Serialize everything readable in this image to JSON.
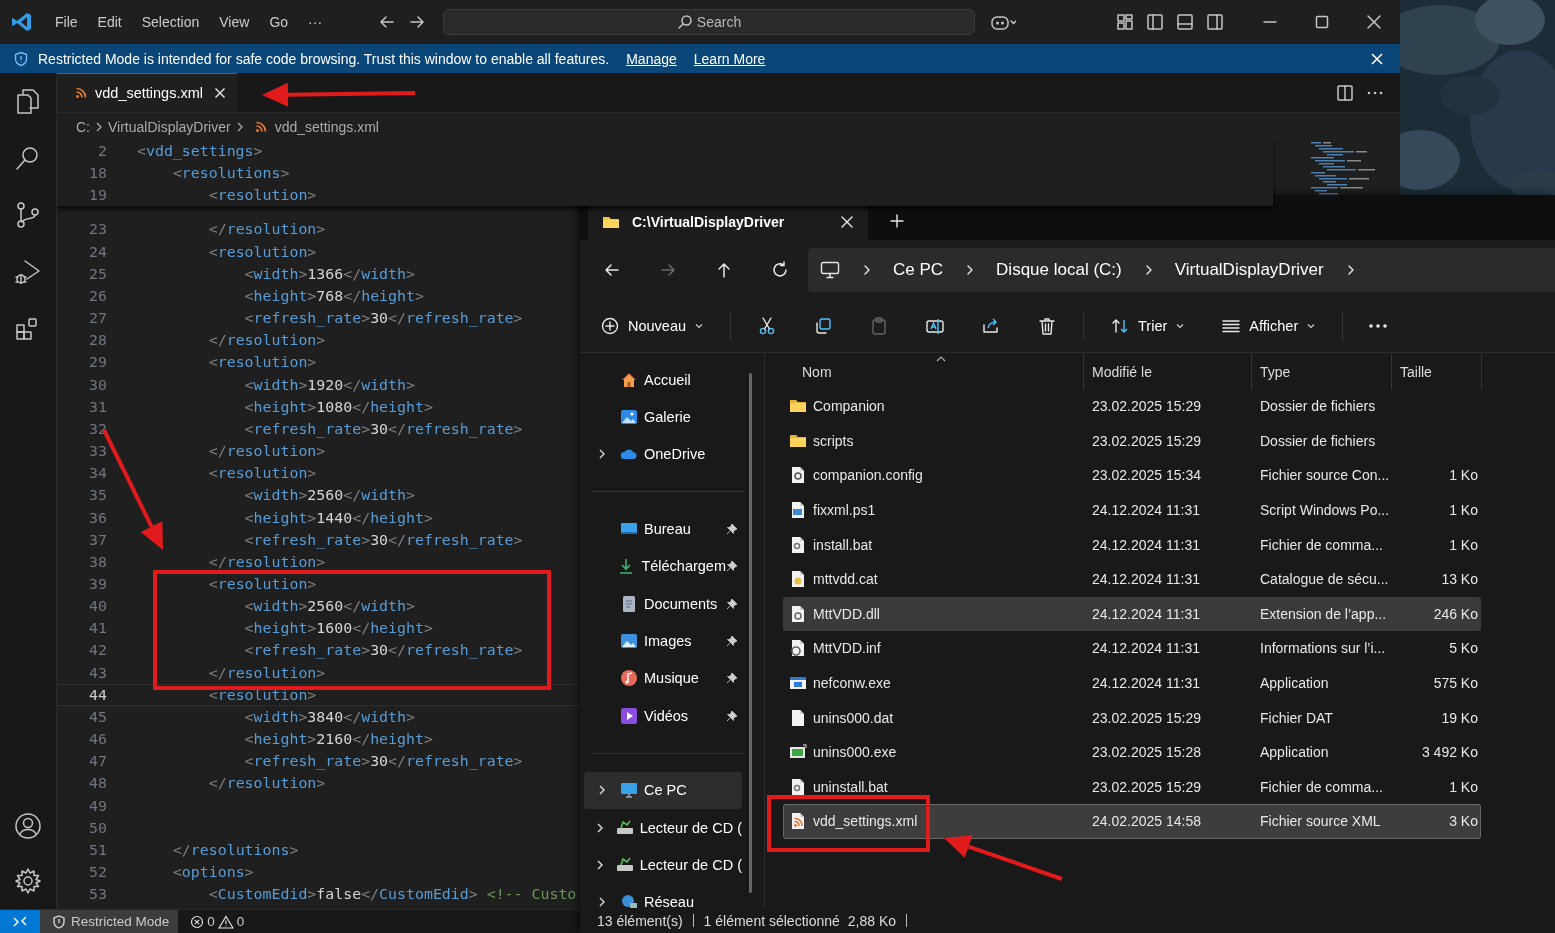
{
  "vscode": {
    "menu": [
      "File",
      "Edit",
      "Selection",
      "View",
      "Go",
      "···"
    ],
    "search": {
      "placeholder": "Search"
    },
    "banner": {
      "text": "Restricted Mode is intended for safe code browsing. Trust this window to enable all features.",
      "links": [
        "Manage",
        "Learn More"
      ]
    },
    "tabs": [
      {
        "label": "vdd_settings.xml",
        "selected": true
      }
    ],
    "breadcrumb": [
      "C:",
      "VirtualDisplayDriver",
      "vdd_settings.xml"
    ],
    "sticky_lines": [
      {
        "number": "2",
        "text": "<vdd_settings>"
      },
      {
        "number": "18",
        "text": "    <resolutions>"
      },
      {
        "number": "19",
        "text": "        <resolution>"
      }
    ],
    "lines": [
      {
        "number": "23",
        "text": "        </resolution>",
        "current": false
      },
      {
        "number": "24",
        "text": "        <resolution>",
        "current": false
      },
      {
        "number": "25",
        "text": "            <width>1366</width>",
        "current": false
      },
      {
        "number": "26",
        "text": "            <height>768</height>",
        "current": false
      },
      {
        "number": "27",
        "text": "            <refresh_rate>30</refresh_rate>",
        "current": false
      },
      {
        "number": "28",
        "text": "        </resolution>",
        "current": false
      },
      {
        "number": "29",
        "text": "        <resolution>",
        "current": false
      },
      {
        "number": "30",
        "text": "            <width>1920</width>",
        "current": false
      },
      {
        "number": "31",
        "text": "            <height>1080</height>",
        "current": false
      },
      {
        "number": "32",
        "text": "            <refresh_rate>30</refresh_rate>",
        "current": false
      },
      {
        "number": "33",
        "text": "        </resolution>",
        "current": false
      },
      {
        "number": "34",
        "text": "        <resolution>",
        "current": false
      },
      {
        "number": "35",
        "text": "            <width>2560</width>",
        "current": false
      },
      {
        "number": "36",
        "text": "            <height>1440</height>",
        "current": false
      },
      {
        "number": "37",
        "text": "            <refresh_rate>30</refresh_rate>",
        "current": false
      },
      {
        "number": "38",
        "text": "        </resolution>",
        "current": false
      },
      {
        "number": "39",
        "text": "        <resolution>",
        "current": false
      },
      {
        "number": "40",
        "text": "            <width>2560</width>",
        "current": false
      },
      {
        "number": "41",
        "text": "            <height>1600</height>",
        "current": false
      },
      {
        "number": "42",
        "text": "            <refresh_rate>30</refresh_rate>",
        "current": false
      },
      {
        "number": "43",
        "text": "        </resolution>",
        "current": false
      },
      {
        "number": "44",
        "text": "        <resolution>",
        "current": true
      },
      {
        "number": "45",
        "text": "            <width>3840</width>",
        "current": false
      },
      {
        "number": "46",
        "text": "            <height>2160</height>",
        "current": false
      },
      {
        "number": "47",
        "text": "            <refresh_rate>30</refresh_rate>",
        "current": false
      },
      {
        "number": "48",
        "text": "        </resolution>",
        "current": false
      },
      {
        "number": "49",
        "current": false
      },
      {
        "number": "50",
        "current": false
      },
      {
        "number": "51",
        "text": "    </resolutions>",
        "current": false
      },
      {
        "number": "52",
        "text": "    <options>",
        "current": false
      },
      {
        "number": "53",
        "text": "        <CustomEdid>false</CustomEdid> <!-- Custo",
        "current": false
      }
    ],
    "status_bar": {
      "mode": "Restricted Mode",
      "errors": "0",
      "warnings": "0"
    }
  },
  "explorer": {
    "tab": {
      "title": "C:\\VirtualDisplayDriver"
    },
    "nav_buttons": [
      {
        "kind": "back",
        "disabled": false
      },
      {
        "kind": "forward",
        "disabled": true
      },
      {
        "kind": "up",
        "disabled": false
      },
      {
        "kind": "refresh",
        "disabled": false
      }
    ],
    "address": [
      "Ce PC",
      "Disque local (C:)",
      "VirtualDisplayDriver"
    ],
    "toolbar": [
      {
        "kind": "new",
        "label": "Nouveau",
        "disabled": false
      },
      {
        "kind": "cut",
        "disabled": false
      },
      {
        "kind": "copy",
        "disabled": false
      },
      {
        "kind": "paste",
        "disabled": true
      },
      {
        "kind": "rename",
        "disabled": false
      },
      {
        "kind": "share",
        "disabled": false
      },
      {
        "kind": "delete",
        "disabled": false
      },
      {
        "kind": "sort",
        "label": "Trier",
        "disabled": false
      },
      {
        "kind": "view",
        "label": "Afficher",
        "disabled": false
      },
      {
        "kind": "more",
        "disabled": false
      }
    ],
    "navigation": [
      {
        "items": [
          {
            "label": "Accueil",
            "kind": "home",
            "expandable": false,
            "pinned": false,
            "selected": false
          },
          {
            "label": "Galerie",
            "kind": "gallery",
            "expandable": false,
            "pinned": false,
            "selected": false
          },
          {
            "label": "OneDrive",
            "kind": "cloud",
            "expandable": true,
            "pinned": false,
            "selected": false
          }
        ]
      },
      {
        "items": [
          {
            "label": "Bureau",
            "kind": "desktop",
            "expandable": false,
            "pinned": true,
            "selected": false
          },
          {
            "label": "Téléchargem",
            "kind": "downloads",
            "expandable": false,
            "pinned": true,
            "selected": false
          },
          {
            "label": "Documents",
            "kind": "documents",
            "expandable": false,
            "pinned": true,
            "selected": false
          },
          {
            "label": "Images",
            "kind": "pictures",
            "expandable": false,
            "pinned": true,
            "selected": false
          },
          {
            "label": "Musique",
            "kind": "music",
            "expandable": false,
            "pinned": true,
            "selected": false
          },
          {
            "label": "Vidéos",
            "kind": "videos",
            "expandable": false,
            "pinned": true,
            "selected": false
          }
        ]
      },
      {
        "items": [
          {
            "label": "Ce PC",
            "kind": "computer",
            "expandable": true,
            "pinned": false,
            "selected": true
          },
          {
            "label": "Lecteur de CD (",
            "kind": "cd-drive",
            "expandable": true,
            "pinned": false,
            "selected": false
          },
          {
            "label": "Lecteur de CD (",
            "kind": "cd-drive",
            "expandable": true,
            "pinned": false,
            "selected": false
          },
          {
            "label": "Réseau",
            "kind": "network",
            "expandable": true,
            "pinned": false,
            "selected": false
          }
        ]
      }
    ],
    "columns": [
      "Nom",
      "Modifié le",
      "Type",
      "Taille"
    ],
    "files": [
      {
        "name": "Companion",
        "modified": "23.02.2025 15:29",
        "type": "Dossier de fichiers",
        "kind": "folder",
        "selected": false,
        "hovered": false
      },
      {
        "name": "scripts",
        "modified": "23.02.2025 15:29",
        "type": "Dossier de fichiers",
        "kind": "folder",
        "selected": false,
        "hovered": false
      },
      {
        "name": "companion.config",
        "modified": "23.02.2025 15:34",
        "type": "Fichier source Con...",
        "size": "1 Ko",
        "kind": "config",
        "selected": false,
        "hovered": false
      },
      {
        "name": "fixxml.ps1",
        "modified": "24.12.2024 11:31",
        "type": "Script Windows Po...",
        "size": "1 Ko",
        "kind": "script",
        "selected": false,
        "hovered": false
      },
      {
        "name": "install.bat",
        "modified": "24.12.2024 11:31",
        "type": "Fichier de comma...",
        "size": "1 Ko",
        "kind": "batch",
        "selected": false,
        "hovered": false
      },
      {
        "name": "mttvdd.cat",
        "modified": "24.12.2024 11:31",
        "type": "Catalogue de sécu...",
        "size": "13 Ko",
        "kind": "catalog",
        "selected": false,
        "hovered": false
      },
      {
        "name": "MttVDD.dll",
        "modified": "24.12.2024 11:31",
        "type": "Extension de l’app...",
        "size": "246 Ko",
        "kind": "library",
        "selected": false,
        "hovered": true
      },
      {
        "name": "MttVDD.inf",
        "modified": "24.12.2024 11:31",
        "type": "Informations sur l’i...",
        "size": "5 Ko",
        "kind": "setup-info",
        "selected": false,
        "hovered": false
      },
      {
        "name": "nefconw.exe",
        "modified": "24.12.2024 11:31",
        "type": "Application",
        "size": "575 Ko",
        "kind": "application",
        "selected": false,
        "hovered": false
      },
      {
        "name": "unins000.dat",
        "modified": "23.02.2025 15:29",
        "type": "Fichier DAT",
        "size": "19 Ko",
        "kind": "data",
        "selected": false,
        "hovered": false
      },
      {
        "name": "unins000.exe",
        "modified": "23.02.2025 15:28",
        "type": "Application",
        "size": "3 492 Ko",
        "kind": "installer",
        "selected": false,
        "hovered": false
      },
      {
        "name": "uninstall.bat",
        "modified": "23.02.2025 15:29",
        "type": "Fichier de comma...",
        "size": "1 Ko",
        "kind": "batch",
        "selected": false,
        "hovered": false
      },
      {
        "name": "vdd_settings.xml",
        "modified": "24.02.2025 14:58",
        "type": "Fichier source XML",
        "size": "3 Ko",
        "kind": "xml",
        "selected": true,
        "hovered": false
      }
    ],
    "status": [
      "13 élément(s)",
      "1 élément sélectionné",
      "2,88 Ko"
    ]
  },
  "annotations": [
    {
      "kind": "arrow"
    },
    {
      "kind": "arrow"
    },
    {
      "kind": "frame"
    },
    {
      "kind": "frame"
    },
    {
      "kind": "arrow"
    }
  ]
}
